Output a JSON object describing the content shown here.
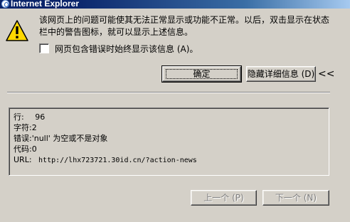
{
  "window": {
    "title": "Internet Explorer"
  },
  "message": {
    "line1": "该网页上的问题可能使其无法正常显示或功能不正常。以后，双击显示在状态",
    "line2": "栏中的警告图标，就可以显示上述信息。"
  },
  "checkbox": {
    "label": "网页包含错误时始终显示该信息 (A)。",
    "checked": false
  },
  "buttons": {
    "ok": "确定",
    "hide_details": "隐藏详细信息 (D)",
    "hide_details_chevron": "<<",
    "prev": "上一个 (P)",
    "next": "下一个 (N)"
  },
  "details": {
    "line_label": "行:",
    "line_value": "96",
    "char_label": "字符:",
    "char_value": "2",
    "error_label": "错误:",
    "error_value": "'null' 为空或不是对象",
    "code_label": "代码:",
    "code_value": "0",
    "url_label": "URL:",
    "url_value": "http://lhx723721.30id.cn/?action-news"
  },
  "icons": {
    "title": "ie-icon",
    "warning": "warning-triangle-icon"
  },
  "colors": {
    "titlebar": "#0a246a",
    "dialog_bg": "#d4d0c8",
    "warning_yellow": "#ffd800"
  }
}
